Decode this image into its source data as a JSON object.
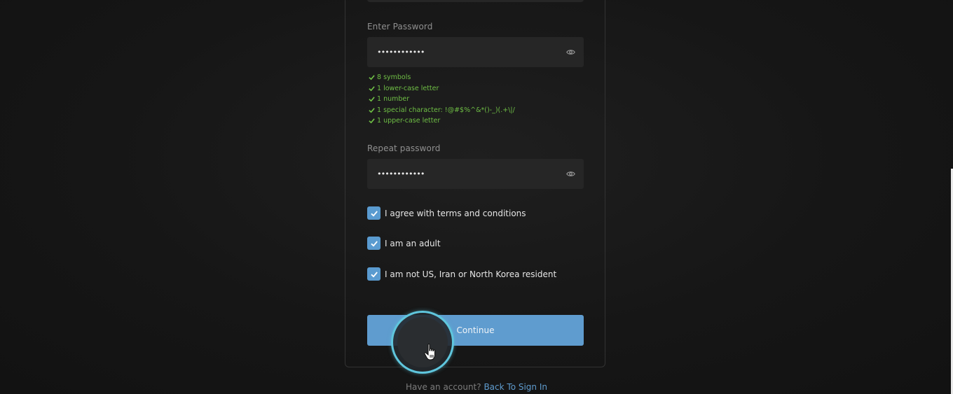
{
  "form": {
    "password": {
      "label": "Enter Password",
      "value": "••••••••••••",
      "icon": "eye-icon"
    },
    "rules": [
      {
        "text": "8 symbols",
        "met": true
      },
      {
        "text": "1 lower-case letter",
        "met": true
      },
      {
        "text": "1 number",
        "met": true
      },
      {
        "text": "1 special character: !@#$%^&*()-_)(.+\\|/",
        "met": true
      },
      {
        "text": "1 upper-case letter",
        "met": true
      }
    ],
    "repeat_password": {
      "label": "Repeat password",
      "value": "••••••••••••",
      "icon": "eye-icon"
    },
    "checkboxes": [
      {
        "label": "I agree with terms and conditions",
        "checked": true
      },
      {
        "label": "I am an adult",
        "checked": true
      },
      {
        "label": "I am not US, Iran or North Korea resident",
        "checked": true
      }
    ],
    "continue_label": "Continue"
  },
  "footer": {
    "prompt": "Have an account?",
    "link": "Back To Sign In"
  },
  "colors": {
    "accent": "#5f9ccf",
    "rule_ok": "#6fbf45",
    "background": "#161616",
    "field": "#262626"
  }
}
